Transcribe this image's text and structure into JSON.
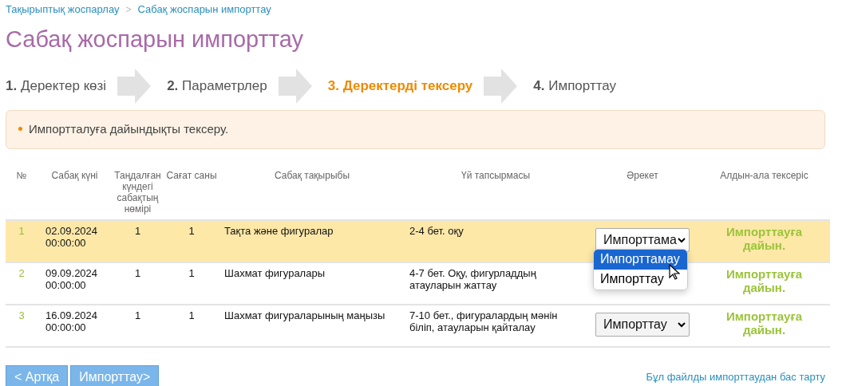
{
  "breadcrumb": [
    "Тақырыптық жоспарлау",
    "Сабақ жоспарын импорттау"
  ],
  "breadcrumb_separator": ">",
  "title": "Сабақ жоспарын импорттау",
  "steps": [
    {
      "number": "1.",
      "label": "Деректер көзі",
      "selected": false
    },
    {
      "number": "2.",
      "label": "Параметрлер",
      "selected": false
    },
    {
      "number": "3.",
      "label": "Деректерді тексеру",
      "selected": true
    },
    {
      "number": "4.",
      "label": "Импорттау",
      "selected": false
    }
  ],
  "notice": [
    "Импортталуға дайындықты тексеру."
  ],
  "table": {
    "columns": [
      "№",
      "Сабақ күні",
      "Таңдалған күндегі сабақтың нөмірі",
      "Сағат саны",
      "Сабақ тақырыбы",
      "Үй тапсырмасы",
      "Әрекет",
      "Алдын-ала тексеріс"
    ],
    "rows": [
      {
        "number": "1",
        "date": "02.09.2024 00:00:00",
        "lesson_number": "1",
        "hours": "1",
        "topic": "Тақта және фигуралар",
        "homework": "2-4 бет. оқу",
        "action": "Импорттама",
        "check": "Импорттауға дайын.",
        "selected": true
      },
      {
        "number": "2",
        "date": "09.09.2024 00:00:00",
        "lesson_number": "1",
        "hours": "1",
        "topic": "Шахмат фигуралары",
        "homework": "4-7 бет. Оқу, фигурладдың атауларын жаттау",
        "check": "Импорттауға дайын.",
        "selected": false
      },
      {
        "number": "3",
        "date": "16.09.2024 00:00:00",
        "lesson_number": "1",
        "hours": "1",
        "topic": "Шахмат фигураларының маңызы",
        "homework": "7-10 бет., фигуралардың мәнін біліп, атауларын қайталау",
        "action": "Импорттау",
        "check": "Импорттауға дайын.",
        "selected": false
      }
    ]
  },
  "dropdown": {
    "options": [
      {
        "label": "Импорттамау",
        "selected": true
      },
      {
        "label": "Импорттау",
        "selected": false
      }
    ]
  },
  "buttons": [
    "< Артқа",
    "Импорттау>"
  ],
  "cancel_link": "Бұл файлды импорттаудан бас тарту"
}
